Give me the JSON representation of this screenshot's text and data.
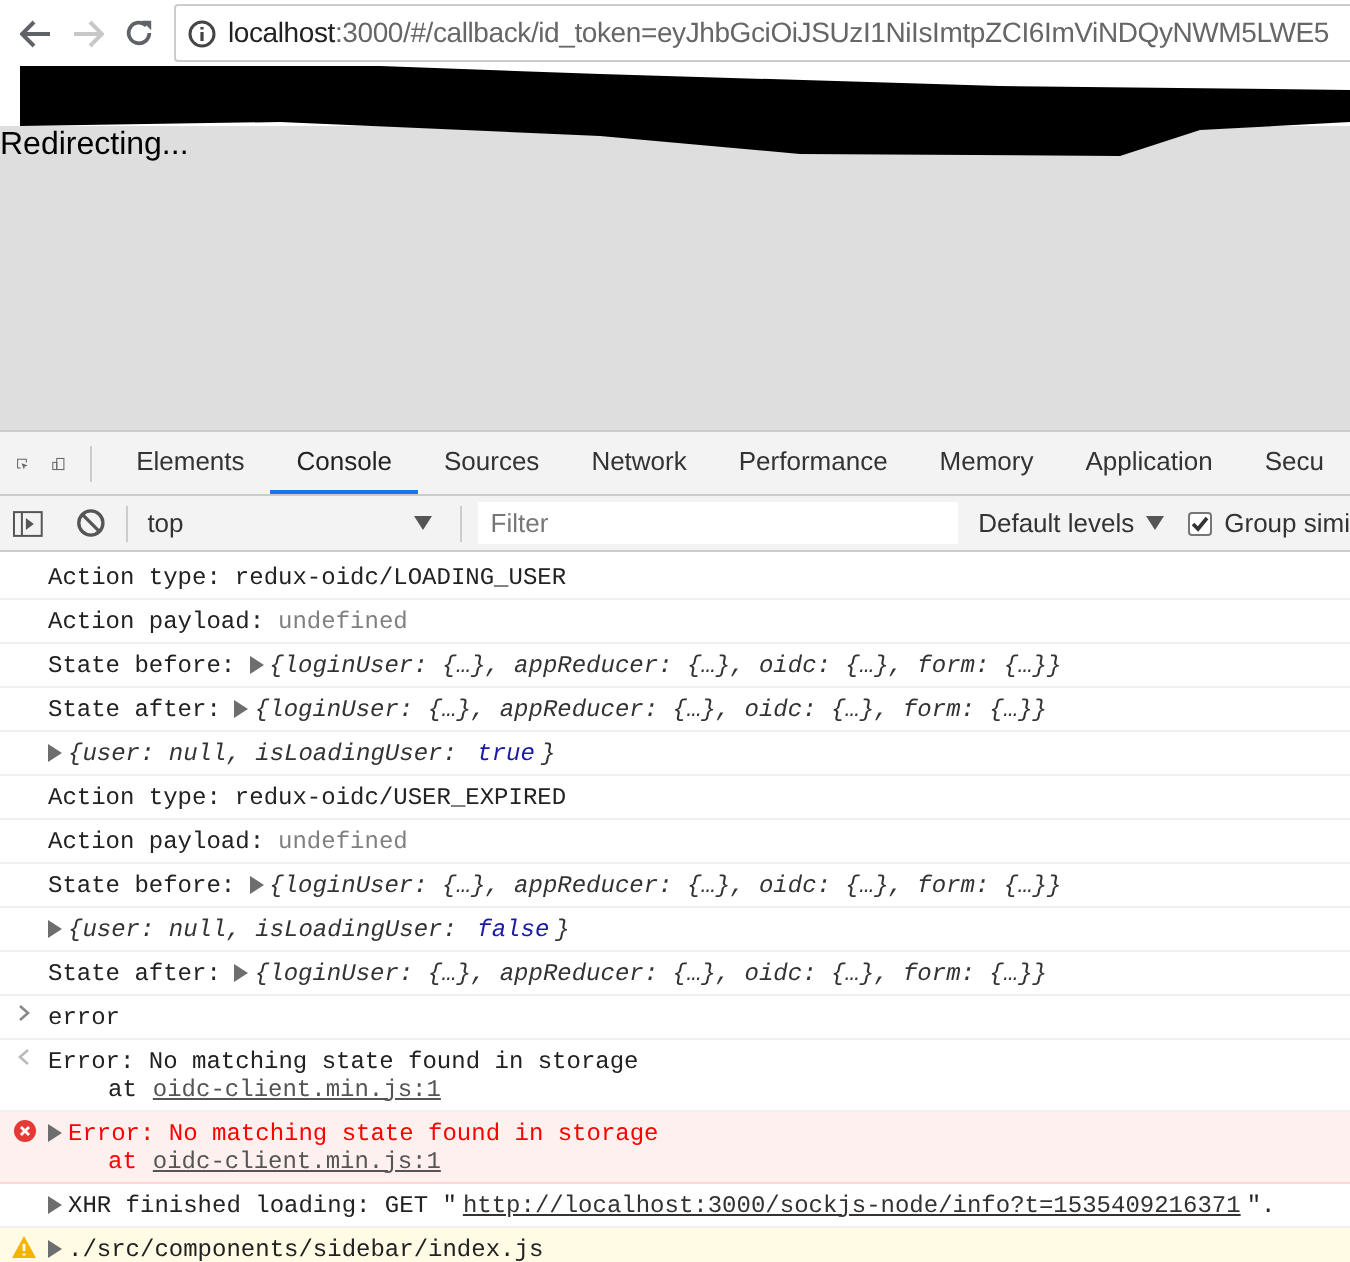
{
  "browser": {
    "back_disabled": false,
    "forward_disabled": true,
    "url_host": "localhost",
    "url_rest": ":3000/#/callback/id_token=eyJhbGciOiJSUzI1NiIsImtpZCI6ImViNDQyNWM5LWE5"
  },
  "page": {
    "text": "Redirecting..."
  },
  "devtools": {
    "tabs": [
      {
        "label": "Elements",
        "selected": false
      },
      {
        "label": "Console",
        "selected": true
      },
      {
        "label": "Sources",
        "selected": false
      },
      {
        "label": "Network",
        "selected": false
      },
      {
        "label": "Performance",
        "selected": false
      },
      {
        "label": "Memory",
        "selected": false
      },
      {
        "label": "Application",
        "selected": false
      },
      {
        "label": "Secu",
        "selected": false
      }
    ],
    "toolbar": {
      "context": "top",
      "filter_placeholder": "Filter",
      "levels": "Default levels",
      "group_label": "Group simi",
      "group_checked": true
    }
  },
  "console": [
    {
      "kind": "log",
      "label": "Action type:",
      "parts": [
        {
          "text": "redux-oidc/LOADING_USER",
          "kind": "plain"
        }
      ]
    },
    {
      "kind": "log",
      "label": "Action payload:",
      "parts": [
        {
          "text": "undefined",
          "kind": "muted"
        }
      ]
    },
    {
      "kind": "object",
      "label": "State before:",
      "parts": [
        {
          "text": "{loginUser: {…}, appReducer: {…}, oidc: {…}, form: {…}}",
          "kind": "italic"
        }
      ]
    },
    {
      "kind": "object",
      "label": "State after:",
      "parts": [
        {
          "text": "{loginUser: {…}, appReducer: {…}, oidc: {…}, form: {…}}",
          "kind": "italic"
        }
      ]
    },
    {
      "kind": "object",
      "parts": [
        {
          "text": "{user: null, isLoadingUser: ",
          "kind": "italic"
        },
        {
          "text": "true",
          "kind": "keyword"
        },
        {
          "text": "}",
          "kind": "italic"
        }
      ]
    },
    {
      "kind": "log",
      "label": "Action type:",
      "parts": [
        {
          "text": "redux-oidc/USER_EXPIRED",
          "kind": "plain"
        }
      ]
    },
    {
      "kind": "log",
      "label": "Action payload:",
      "parts": [
        {
          "text": "undefined",
          "kind": "muted"
        }
      ]
    },
    {
      "kind": "object",
      "label": "State before:",
      "parts": [
        {
          "text": "{loginUser: {…}, appReducer: {…}, oidc: {…}, form: {…}}",
          "kind": "italic"
        }
      ]
    },
    {
      "kind": "object",
      "parts": [
        {
          "text": "{user: null, isLoadingUser: ",
          "kind": "italic"
        },
        {
          "text": "false",
          "kind": "keyword"
        },
        {
          "text": "}",
          "kind": "italic"
        }
      ]
    },
    {
      "kind": "object",
      "label": "State after:",
      "parts": [
        {
          "text": "{loginUser: {…}, appReducer: {…}, oidc: {…}, form: {…}}",
          "kind": "italic"
        }
      ]
    },
    {
      "kind": "input",
      "parts": [
        {
          "text": "error",
          "kind": "plain"
        }
      ]
    },
    {
      "kind": "result",
      "parts": [
        {
          "text": "Error: No matching state found in storage",
          "kind": "plain"
        }
      ],
      "at": "at",
      "link": "oidc-client.min.js:1"
    },
    {
      "kind": "error",
      "parts": [
        {
          "text": "Error: No matching state found in storage",
          "kind": "plain"
        }
      ],
      "at": "at",
      "link": "oidc-client.min.js:1"
    },
    {
      "kind": "xhr",
      "parts": [
        {
          "text": "XHR finished loading: GET \"",
          "kind": "plain"
        },
        {
          "text": "http://localhost:3000/sockjs-node/info?t=1535409216371",
          "kind": "link"
        },
        {
          "text": "\".",
          "kind": "plain"
        }
      ]
    },
    {
      "kind": "warning",
      "parts": [
        {
          "text": "./src/components/sidebar/index.js",
          "kind": "plain"
        }
      ]
    }
  ]
}
